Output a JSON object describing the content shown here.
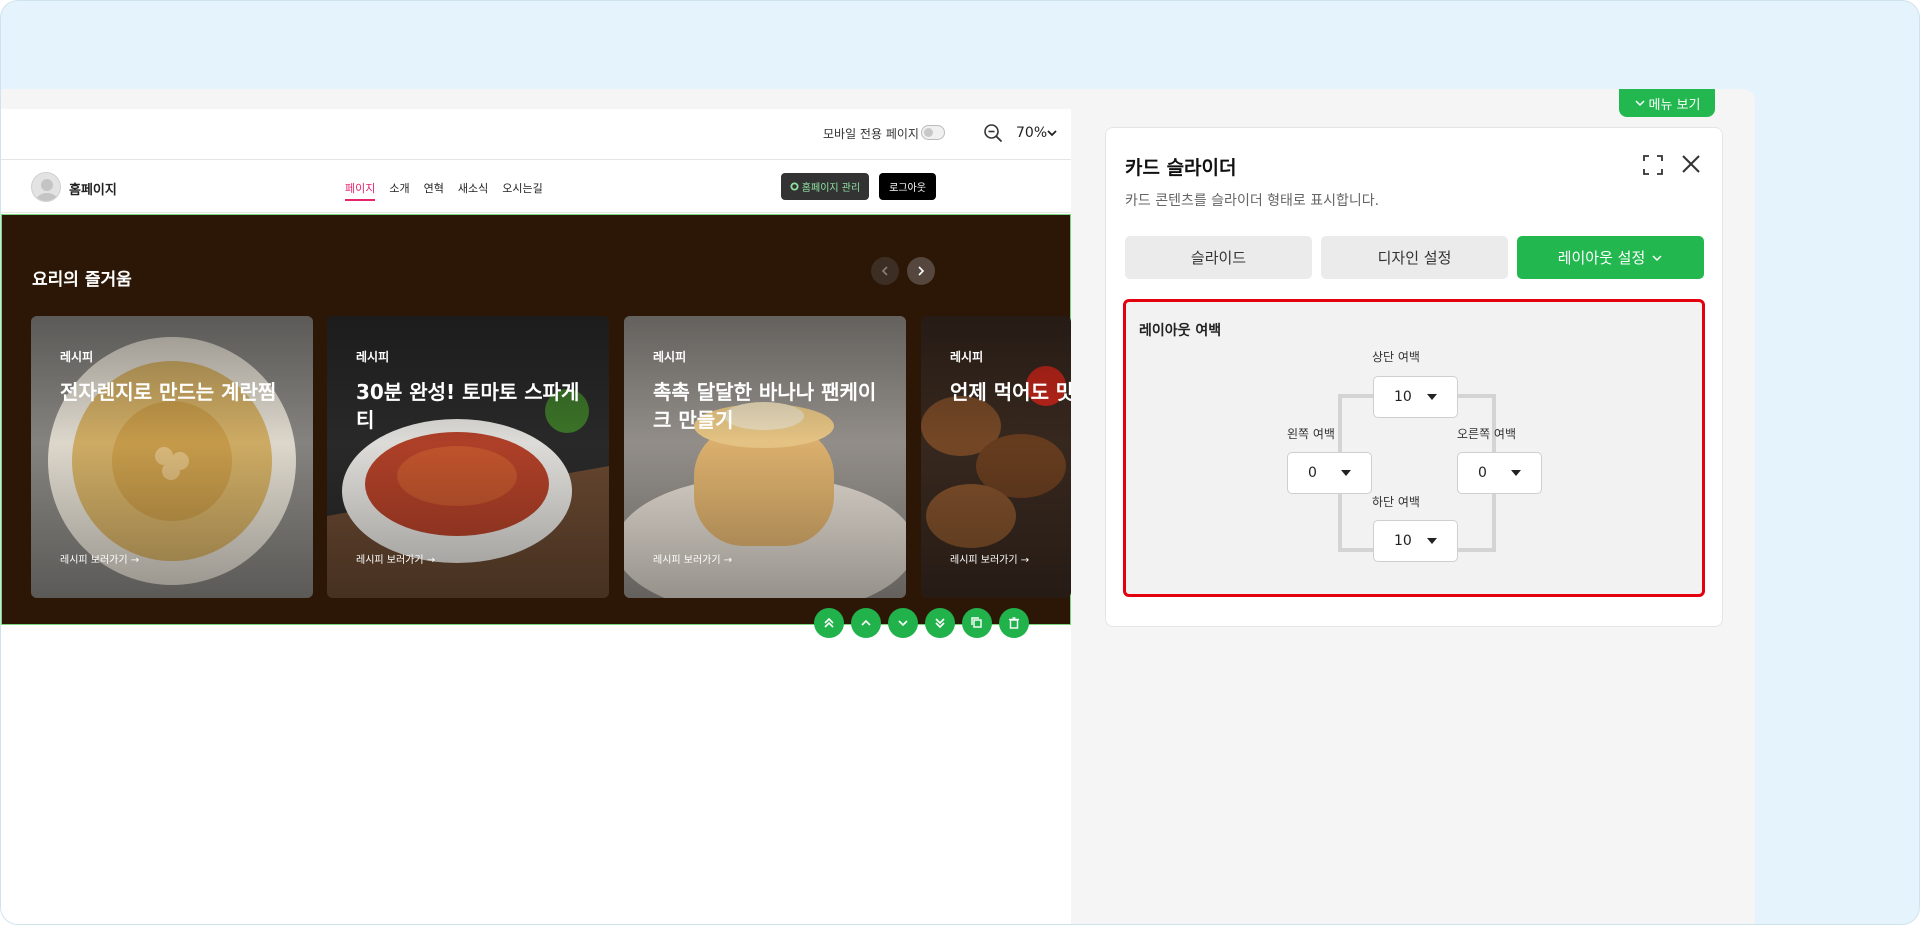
{
  "preview": {
    "topbar": {
      "mobile_label": "모바일 전용 페이지",
      "zoom": "70%"
    },
    "header": {
      "site_name": "홈페이지",
      "nav": [
        {
          "label": "페이지",
          "active": true
        },
        {
          "label": "소개",
          "active": false
        },
        {
          "label": "연혁",
          "active": false
        },
        {
          "label": "새소식",
          "active": false
        },
        {
          "label": "오시는길",
          "active": false
        }
      ],
      "manage_label": "홈페이지 관리",
      "logout_label": "로그아웃"
    },
    "section": {
      "title": "요리의 즐거움",
      "cards": [
        {
          "tag": "레시피",
          "title": "전자렌지로 만드는 계란찜",
          "link": "레시피 보러가기 →"
        },
        {
          "tag": "레시피",
          "title": "30분 완성! 토마토 스파게티",
          "link": "레시피 보러가기 →"
        },
        {
          "tag": "레시피",
          "title": "촉촉 달달한 바나나 팬케이크 만들기",
          "link": "레시피 보러가기 →"
        },
        {
          "tag": "레시피",
          "title": "언제 먹어도 맛",
          "link": "레시피 보러가기 →"
        }
      ]
    },
    "actions": [
      "move-top-icon",
      "move-up-icon",
      "move-down-icon",
      "move-bottom-icon",
      "duplicate-icon",
      "delete-icon"
    ]
  },
  "panel": {
    "menu_view": "메뉴 보기",
    "title": "카드 슬라이더",
    "description": "카드 콘텐츠를 슬라이더 형태로 표시합니다.",
    "tabs": [
      {
        "label": "슬라이드"
      },
      {
        "label": "디자인 설정"
      },
      {
        "label": "레이아웃 설정"
      }
    ],
    "layout": {
      "title": "레이아웃 여백",
      "top": {
        "label": "상단 여백",
        "value": "10"
      },
      "left": {
        "label": "왼쪽 여백",
        "value": "0"
      },
      "right": {
        "label": "오른쪽 여백",
        "value": "0"
      },
      "bottom": {
        "label": "하단 여백",
        "value": "10"
      }
    }
  },
  "colors": {
    "accent": "#22b84f",
    "highlight": "#e3000f",
    "section_bg": "#2c1706",
    "nav_active": "#e6246c"
  }
}
